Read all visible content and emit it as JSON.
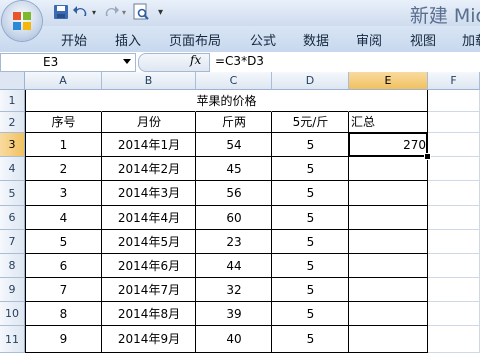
{
  "title_bar": {
    "title": "新建 Mic"
  },
  "ribbon": {
    "tabs": [
      "开始",
      "插入",
      "页面布局",
      "公式",
      "数据",
      "审阅",
      "视图",
      "加载"
    ]
  },
  "formula_bar": {
    "name_box": "E3",
    "fx_label": "fx",
    "formula": "=C3*D3"
  },
  "columns": [
    "A",
    "B",
    "C",
    "D",
    "E",
    "F"
  ],
  "rows": [
    "1",
    "2",
    "3",
    "4",
    "5",
    "6",
    "7",
    "8",
    "9",
    "10",
    "11"
  ],
  "sheet": {
    "table_title": "苹果的价格",
    "headers": [
      "序号",
      "月份",
      "斤两",
      "5元/斤",
      "汇总"
    ],
    "data": [
      [
        "1",
        "2014年1月",
        "54",
        "5",
        "270"
      ],
      [
        "2",
        "2014年2月",
        "45",
        "5",
        ""
      ],
      [
        "3",
        "2014年3月",
        "56",
        "5",
        ""
      ],
      [
        "4",
        "2014年4月",
        "60",
        "5",
        ""
      ],
      [
        "5",
        "2014年5月",
        "23",
        "5",
        ""
      ],
      [
        "6",
        "2014年6月",
        "44",
        "5",
        ""
      ],
      [
        "7",
        "2014年7月",
        "32",
        "5",
        ""
      ],
      [
        "8",
        "2014年8月",
        "39",
        "5",
        ""
      ],
      [
        "9",
        "2014年9月",
        "40",
        "5",
        ""
      ]
    ]
  },
  "icons": [
    "office-button",
    "save-icon",
    "undo-icon",
    "redo-icon",
    "print-preview-icon",
    "customize-arrow-icon",
    "namebox-dropdown-icon"
  ]
}
